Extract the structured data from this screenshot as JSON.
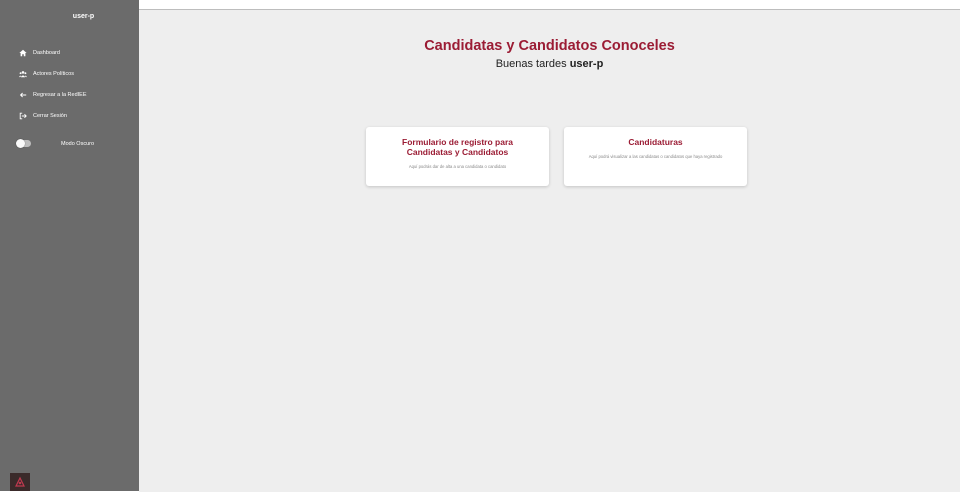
{
  "sidebar": {
    "username": "user-p",
    "items": [
      {
        "label": "Dashboard",
        "icon": "home-icon"
      },
      {
        "label": "Actores Políticos",
        "icon": "users-icon"
      },
      {
        "label": "Regresar a la RedIEE",
        "icon": "arrow-left-icon"
      },
      {
        "label": "Cerrar Sesión",
        "icon": "logout-icon"
      }
    ],
    "dark_mode_label": "Modo Oscuro",
    "dark_mode_on": false
  },
  "main": {
    "title": "Candidatas y Candidatos Conoceles",
    "greeting_prefix": "Buenas tardes ",
    "greeting_user": "user-p",
    "cards": [
      {
        "title": "Formulario de registro para Candidatas y Candidatos",
        "description": "Aquí podrás dar de alta a una candidata o candidato"
      },
      {
        "title": "Candidaturas",
        "description": "Aquí podrá visualizar a las candidatas o candidatos que haya registrado"
      }
    ]
  },
  "colors": {
    "accent": "#9b1c34",
    "sidebar_bg": "#6b6b6b",
    "main_bg": "#eeeeee"
  }
}
